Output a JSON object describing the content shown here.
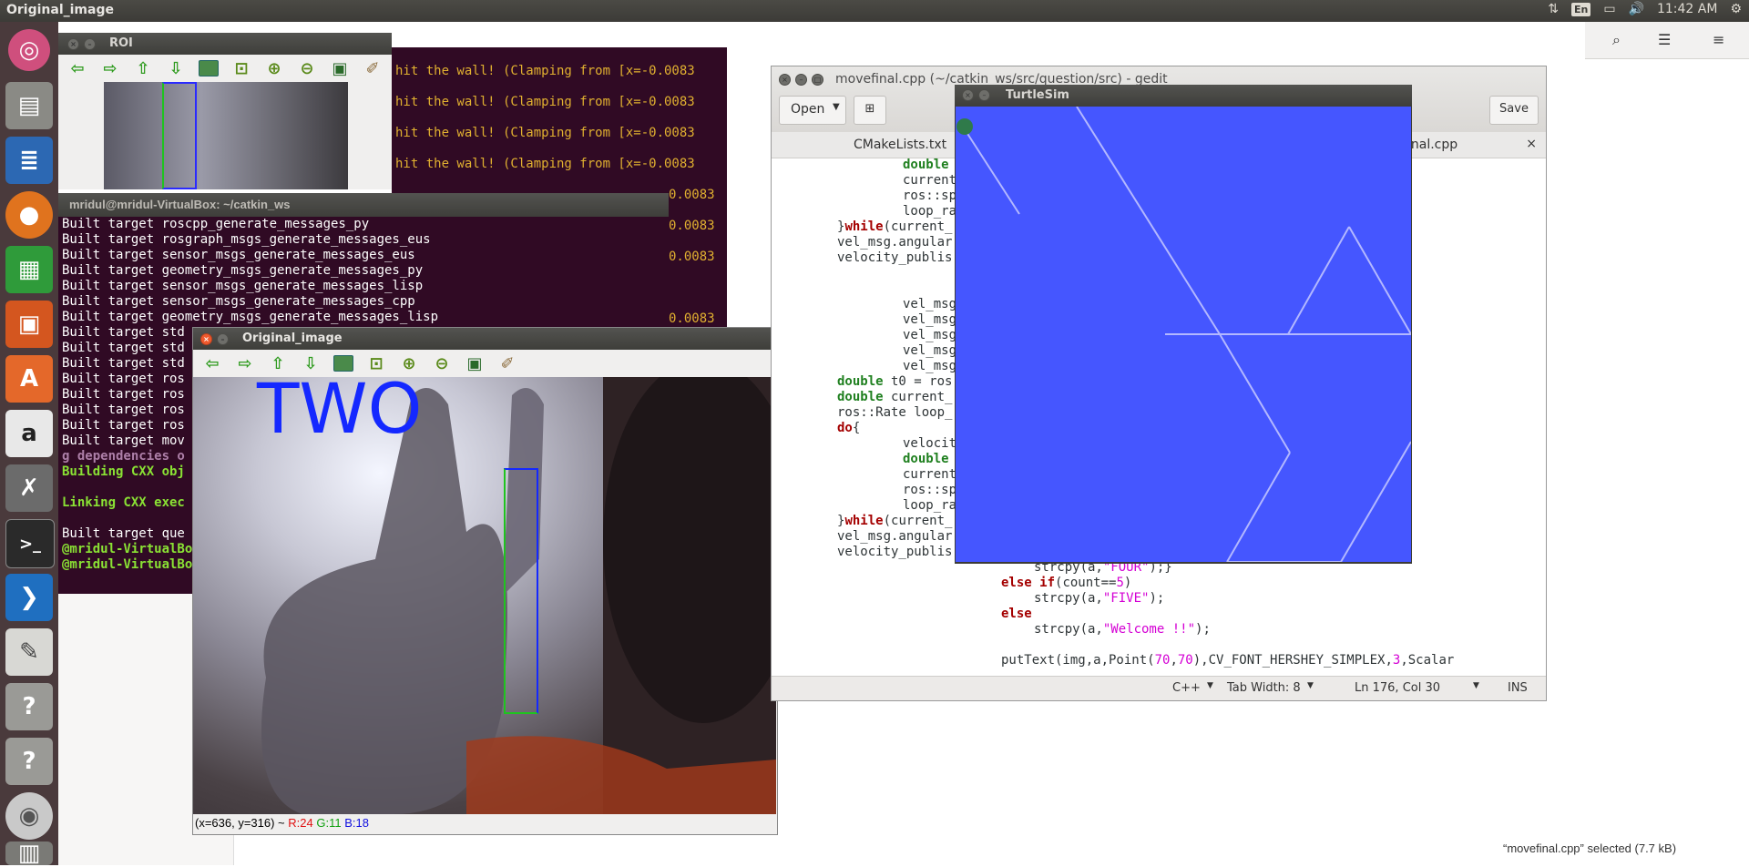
{
  "top_panel": {
    "title": "Original_image",
    "lang": "En",
    "time": "11:42 AM"
  },
  "launcher": {
    "items": [
      "Ubuntu Dash",
      "Files",
      "LibreOffice Writer",
      "Firefox",
      "LibreOffice Calc",
      "LibreOffice Impress",
      "Ubuntu Software",
      "Amazon",
      "System Settings",
      "Terminal",
      "Visual Studio Code",
      "Text Editor",
      "Unknown",
      "Unknown",
      "DVD",
      "Trash"
    ]
  },
  "roi_window": {
    "title": "ROI"
  },
  "bg_terminal": {
    "lines": [
      "hit the wall! (Clamping from [x=-0.0083",
      "hit the wall! (Clamping from [x=-0.0083",
      "hit the wall! (Clamping from [x=-0.0083",
      "hit the wall! (Clamping from [x=-0.0083",
      "0.0083",
      "0.0083",
      "0.0083",
      "0.0083"
    ]
  },
  "terminal": {
    "title": "mridul@mridul-VirtualBox: ~/catkin_ws",
    "lines": [
      {
        "text": "Built target roscpp_generate_messages_py",
        "color": "#ffffff"
      },
      {
        "text": "Built target rosgraph_msgs_generate_messages_eus",
        "color": "#ffffff"
      },
      {
        "text": "Built target sensor_msgs_generate_messages_eus",
        "color": "#ffffff"
      },
      {
        "text": "Built target geometry_msgs_generate_messages_py",
        "color": "#ffffff"
      },
      {
        "text": "Built target sensor_msgs_generate_messages_lisp",
        "color": "#ffffff"
      },
      {
        "text": "Built target sensor_msgs_generate_messages_cpp",
        "color": "#ffffff"
      },
      {
        "text": "Built target geometry_msgs_generate_messages_lisp",
        "color": "#ffffff"
      },
      {
        "text": "Built target std",
        "color": "#ffffff"
      },
      {
        "text": "Built target std",
        "color": "#ffffff"
      },
      {
        "text": "Built target std",
        "color": "#ffffff"
      },
      {
        "text": "Built target ros",
        "color": "#ffffff"
      },
      {
        "text": "Built target ros",
        "color": "#ffffff"
      },
      {
        "text": "Built target ros",
        "color": "#ffffff"
      },
      {
        "text": "Built target ros",
        "color": "#ffffff"
      },
      {
        "text": "Built target mov",
        "color": "#ffffff"
      },
      {
        "text": "g dependencies o",
        "color": "#ad7fa8"
      },
      {
        "text": "Building CXX obj",
        "color": "#8ae234"
      },
      {
        "text": "",
        "color": "#ffffff"
      },
      {
        "text": "Linking CXX exec",
        "color": "#8ae234"
      },
      {
        "text": "",
        "color": "#ffffff"
      },
      {
        "text": "Built target que",
        "color": "#ffffff"
      },
      {
        "text": "@mridul-VirtualBo",
        "color": "#8ae234"
      },
      {
        "text": "@mridul-VirtualBo",
        "color": "#8ae234"
      }
    ]
  },
  "original_window": {
    "title": "Original_image",
    "overlay_text": "TWO",
    "status": {
      "coords": "(x=636, y=316) ~",
      "r": "R:24",
      "g": "G:11",
      "b": "B:18"
    }
  },
  "gedit": {
    "title": "movefinal.cpp (~/catkin_ws/src/question/src) - gedit",
    "open_label": "Open",
    "save_label": "Save",
    "tabs": [
      {
        "label": "CMakeLists.txt"
      },
      {
        "label": "inal.cpp"
      }
    ],
    "status": {
      "lang": "C++",
      "tabwidth": "Tab Width: 8",
      "position": "Ln 176, Col 30",
      "mode": "INS"
    }
  },
  "turtlesim": {
    "title": "TurtleSim",
    "bg_color": "#4556ff",
    "line_color": "#b3b8ff"
  },
  "desktop": {
    "selection_status": "“movefinal.cpp” selected  (7.7 kB)"
  }
}
